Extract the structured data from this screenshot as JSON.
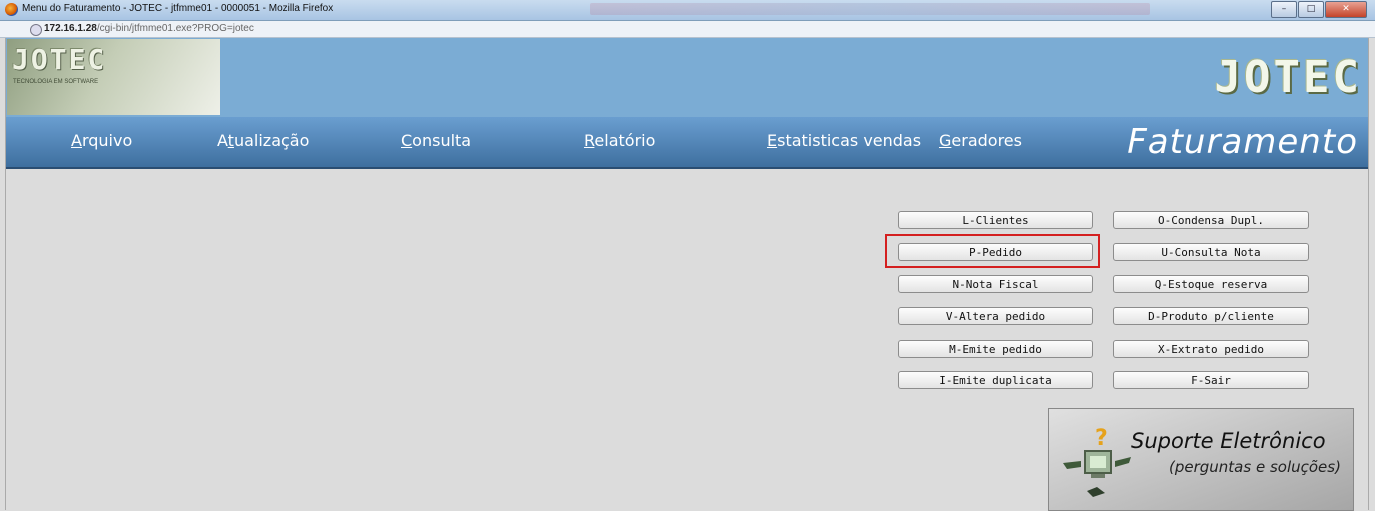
{
  "browser": {
    "window_title": "Menu do Faturamento - JOTEC - jtfmme01 - 0000051 - Mozilla Firefox",
    "url_host": "172.16.1.28",
    "url_path": "/cgi-bin/jtfmme01.exe?PROG=jotec"
  },
  "header": {
    "logo_left": "JOTEC",
    "logo_left_sub": "TECNOLOGIA EM SOFTWARE",
    "logo_right": "JOTEC"
  },
  "menu": {
    "items": [
      {
        "accel": "A",
        "rest": "rquivo"
      },
      {
        "pre": "A",
        "accel": "t",
        "rest": "ualização"
      },
      {
        "accel": "C",
        "rest": "onsulta"
      },
      {
        "accel": "R",
        "rest": "elatório"
      },
      {
        "accel": "E",
        "rest": "statisticas vendas"
      },
      {
        "accel": "G",
        "rest": "eradores"
      }
    ],
    "module_title": "Faturamento"
  },
  "buttons": {
    "left": [
      "L-Clientes",
      "P-Pedido",
      "N-Nota Fiscal",
      "V-Altera pedido",
      "M-Emite pedido",
      "I-Emite duplicata"
    ],
    "right": [
      "O-Condensa Dupl.",
      "U-Consulta Nota",
      "Q-Estoque reserva",
      "D-Produto p/cliente",
      "X-Extrato pedido",
      "F-Sair"
    ]
  },
  "support": {
    "title": "Suporte Eletrônico",
    "subtitle": "(perguntas e soluções)"
  },
  "colors": {
    "header_bg": "#7bacd4",
    "menubar_bg": "#4b7fb1",
    "highlight": "#d42020"
  }
}
